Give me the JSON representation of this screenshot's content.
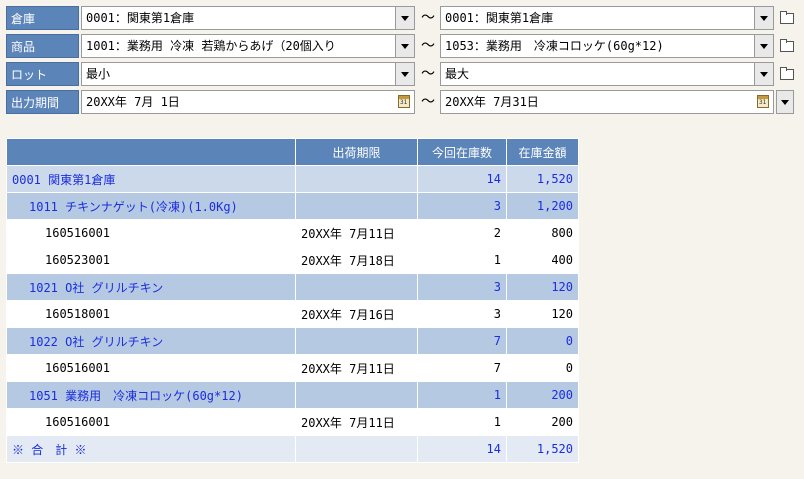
{
  "filters": {
    "warehouse": {
      "label": "倉庫",
      "from": "0001：関東第1倉庫",
      "to": "0001：関東第1倉庫"
    },
    "product": {
      "label": "商品",
      "from": "1001：業務用 冷凍 若鶏からあげ（20個入り",
      "to": "1053：業務用　冷凍コロッケ(60g*12)"
    },
    "lot": {
      "label": "ロット",
      "from": "最小",
      "to": "最大"
    },
    "period": {
      "label": "出力期間",
      "from": "20XX年 7月 1日",
      "to": "20XX年 7月31日"
    },
    "separator": "～"
  },
  "table": {
    "headers": [
      "",
      "出荷期限",
      "今回在庫数",
      "在庫金額"
    ],
    "rows": [
      {
        "level": "lv0",
        "name": "0001 関東第1倉庫",
        "date": "",
        "qty": "14",
        "amount": "1,520"
      },
      {
        "level": "lv1",
        "name": "1011 チキンナゲット(冷凍)(1.0Kg)",
        "date": "",
        "qty": "3",
        "amount": "1,200"
      },
      {
        "level": "lv2",
        "name": "160516001",
        "date": "20XX年 7月11日",
        "qty": "2",
        "amount": "800"
      },
      {
        "level": "lv2",
        "name": "160523001",
        "date": "20XX年 7月18日",
        "qty": "1",
        "amount": "400"
      },
      {
        "level": "lv1",
        "name": "1021 O社 グリルチキン",
        "date": "",
        "qty": "3",
        "amount": "120"
      },
      {
        "level": "lv2",
        "name": "160518001",
        "date": "20XX年 7月16日",
        "qty": "3",
        "amount": "120"
      },
      {
        "level": "lv1",
        "name": "1022 O社 グリルチキン",
        "date": "",
        "qty": "7",
        "amount": "0"
      },
      {
        "level": "lv2",
        "name": "160516001",
        "date": "20XX年 7月11日",
        "qty": "7",
        "amount": "0"
      },
      {
        "level": "lv1",
        "name": "1051 業務用　冷凍コロッケ(60g*12)",
        "date": "",
        "qty": "1",
        "amount": "200"
      },
      {
        "level": "lv2",
        "name": "160516001",
        "date": "20XX年 7月11日",
        "qty": "1",
        "amount": "200"
      },
      {
        "level": "tot",
        "name": "※ 合　計 ※",
        "date": "",
        "qty": "14",
        "amount": "1,520"
      }
    ]
  }
}
